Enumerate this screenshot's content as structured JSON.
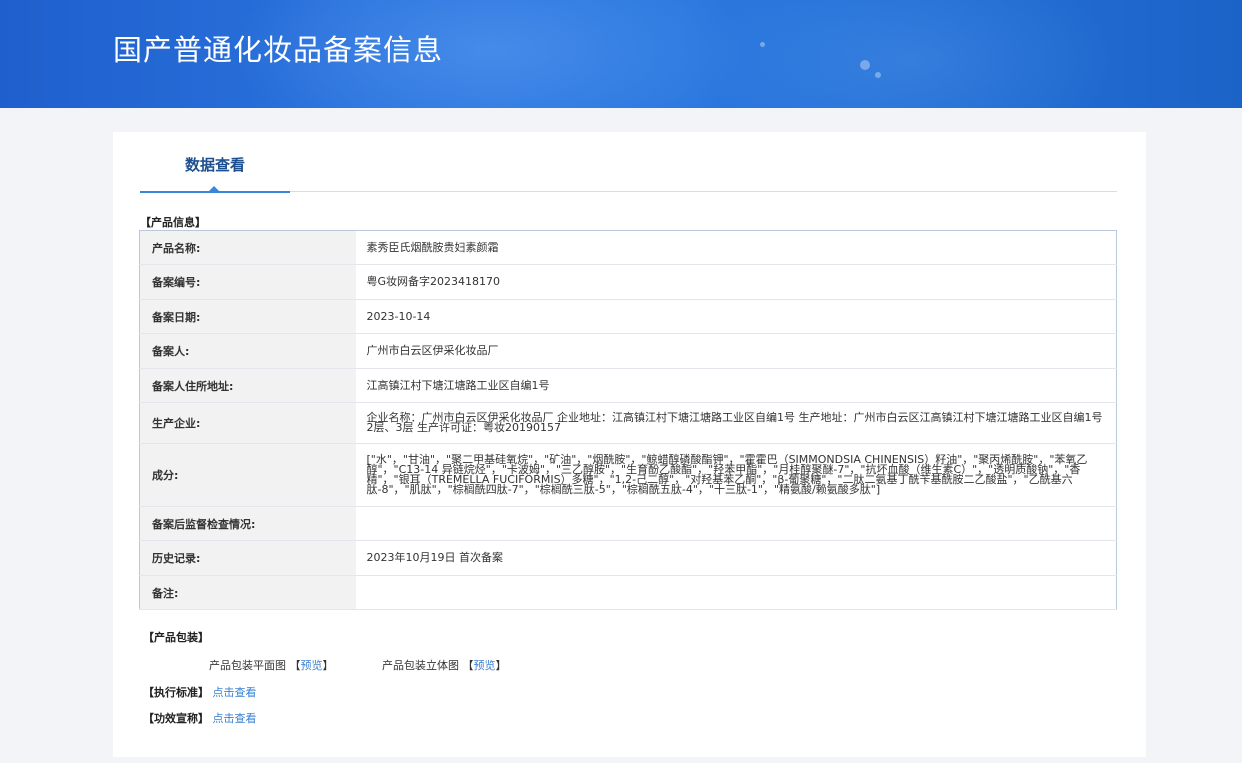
{
  "header": {
    "title": "国产普通化妆品备案信息"
  },
  "tabs": [
    {
      "label": "数据查看",
      "active": true
    }
  ],
  "product_info": {
    "section_title": "【产品信息】",
    "rows": [
      {
        "label": "产品名称:",
        "value": "素秀臣氏烟酰胺贵妇素颜霜"
      },
      {
        "label": "备案编号:",
        "value": "粤G妆网备字2023418170"
      },
      {
        "label": "备案日期:",
        "value": "2023-10-14"
      },
      {
        "label": "备案人:",
        "value": "广州市白云区伊采化妆品厂"
      },
      {
        "label": "备案人住所地址:",
        "value": "江高镇江村下塘江塘路工业区自编1号"
      },
      {
        "label": "生产企业:",
        "value": "企业名称：广州市白云区伊采化妆品厂 企业地址：江高镇江村下塘江塘路工业区自编1号 生产地址：广州市白云区江高镇江村下塘江塘路工业区自编1号2层、3层 生产许可证：粤妆20190157"
      },
      {
        "label": "成分:",
        "value": "[\"水\"，\"甘油\"，\"聚二甲基硅氧烷\"，\"矿油\"，\"烟酰胺\"，\"鲸蜡醇磷酸酯钾\"，\"霍霍巴（SIMMONDSIA CHINENSIS）籽油\"，\"聚丙烯酰胺\"，\"苯氧乙醇\"，\"C13-14 异链烷烃\"，\"卡波姆\"，\"三乙醇胺\"，\"生育酚乙酸酯\"，\"羟苯甲酯\"，\"月桂醇聚醚-7\"，\"抗坏血酸（维生素C）\"，\"透明质酸钠\"，\"香精\"，\"银耳（TREMELLA FUCIFORMIS）多糖\"，\"1,2-己二醇\"，\"对羟基苯乙酮\"，\"β-葡聚糖\"，\"二肽二氨基丁酰苄基酰胺二乙酸盐\"，\"乙酰基六肽-8\"，\"肌肽\"，\"棕榈酰四肽-7\"，\"棕榈酰三肽-5\"，\"棕榈酰五肽-4\"，\"十三肽-1\"，\"精氨酸/赖氨酸多肽\"]"
      },
      {
        "label": "备案后监督检查情况:",
        "value": ""
      },
      {
        "label": "历史记录:",
        "value": "2023年10月19日 首次备案"
      },
      {
        "label": "备注:",
        "value": ""
      }
    ]
  },
  "packaging": {
    "section_title": "【产品包装】",
    "flat_label": "产品包装平面图",
    "solid_label": "产品包装立体图",
    "bracket_open": "【",
    "bracket_close": "】",
    "preview_label": "预览"
  },
  "standard": {
    "label": "【执行标准】",
    "link": "点击查看"
  },
  "efficacy": {
    "label": "【功效宣称】",
    "link": "点击查看"
  }
}
